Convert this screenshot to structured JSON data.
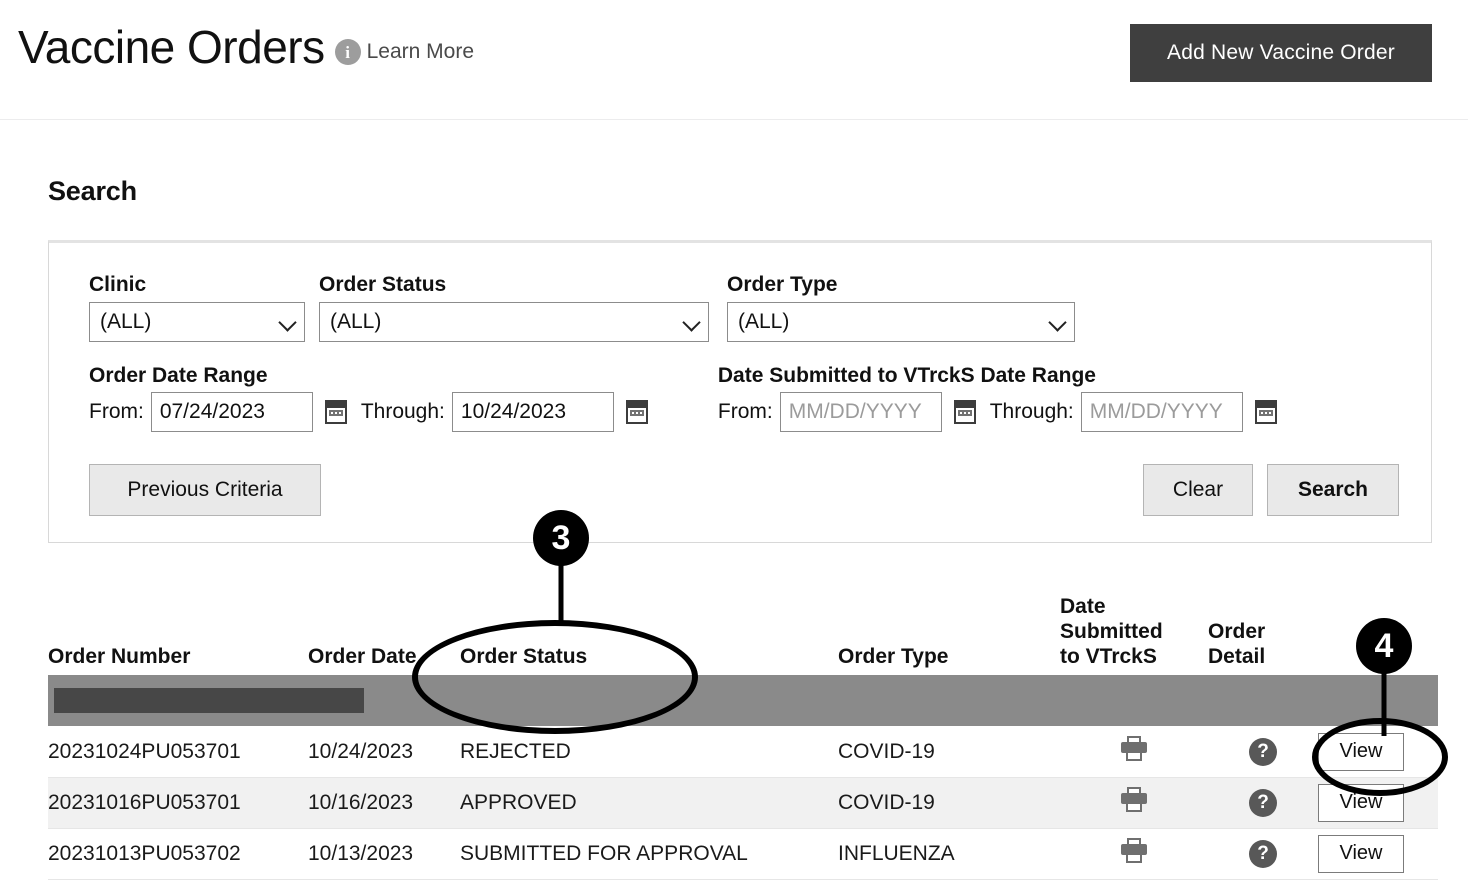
{
  "header": {
    "title": "Vaccine Orders",
    "info_icon": "info-icon",
    "learn_more": "Learn More",
    "add_order_button": "Add New Vaccine Order"
  },
  "search": {
    "heading": "Search",
    "fields": [
      {
        "label": "Clinic",
        "value": "(ALL)"
      },
      {
        "label": "Order Status",
        "value": "(ALL)"
      },
      {
        "label": "Order Type",
        "value": "(ALL)"
      }
    ],
    "order_date_range": {
      "group_label": "Order Date Range",
      "from_label": "From:",
      "from_value": "07/24/2023",
      "through_label": "Through:",
      "through_value": "10/24/2023"
    },
    "vtrcks_date_range": {
      "group_label": "Date Submitted to VTrckS Date Range",
      "from_label": "From:",
      "from_value": "",
      "from_placeholder": "MM/DD/YYYY",
      "through_label": "Through:",
      "through_value": "",
      "through_placeholder": "MM/DD/YYYY"
    },
    "buttons": {
      "previous_criteria": "Previous Criteria",
      "clear": "Clear",
      "search": "Search"
    }
  },
  "table": {
    "headers": {
      "order_number": "Order Number",
      "order_date": "Order Date",
      "order_status": "Order Status",
      "order_type": "Order Type",
      "date_submitted_vtrcks_line1": "Date",
      "date_submitted_vtrcks_line2": "Submitted",
      "date_submitted_vtrcks_line3": "to VTrckS",
      "order_detail_line1": "Order",
      "order_detail_line2": "Detail"
    },
    "rows": [
      {
        "order_number": "20231024PU053701",
        "order_date": "10/24/2023",
        "order_status": "REJECTED",
        "order_type": "COVID-19",
        "date_submitted_to_vtrcks": "",
        "print_icon": "print-icon",
        "help_icon": "question-mark-icon",
        "view_button": "View"
      },
      {
        "order_number": "20231016PU053701",
        "order_date": "10/16/2023",
        "order_status": "APPROVED",
        "order_type": "COVID-19",
        "date_submitted_to_vtrcks": "",
        "print_icon": "print-icon",
        "help_icon": "question-mark-icon",
        "view_button": "View"
      },
      {
        "order_number": "20231013PU053702",
        "order_date": "10/13/2023",
        "order_status": "SUBMITTED FOR APPROVAL",
        "order_type": "INFLUENZA",
        "date_submitted_to_vtrcks": "",
        "print_icon": "print-icon",
        "help_icon": "question-mark-icon",
        "view_button": "View"
      }
    ]
  },
  "annotations": [
    {
      "number": "3",
      "target": "order-status-column"
    },
    {
      "number": "4",
      "target": "view-button"
    }
  ],
  "colors": {
    "button_dark": "#3f3f3f",
    "toolbar_band": "#8a8a8a",
    "toolbar_dark_segment": "#474747",
    "row_alt": "#f1f1f1",
    "annotation": "#000000"
  }
}
